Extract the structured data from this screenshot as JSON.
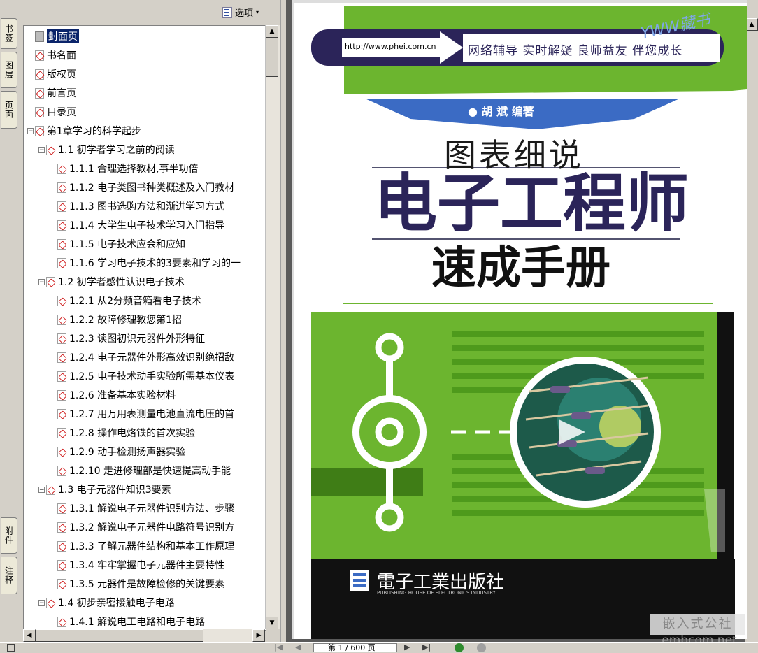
{
  "left_tabs": [
    "书签",
    "图层",
    "页面",
    "附件",
    "注释"
  ],
  "panel": {
    "options_label": "选项",
    "close_glyph": "×"
  },
  "tree": [
    {
      "label": "封面页",
      "level": 0,
      "icon": "page",
      "toggle": "",
      "selected": true
    },
    {
      "label": "书名面",
      "level": 0,
      "icon": "pdf",
      "toggle": ""
    },
    {
      "label": "版权页",
      "level": 0,
      "icon": "pdf",
      "toggle": ""
    },
    {
      "label": "前言页",
      "level": 0,
      "icon": "pdf",
      "toggle": ""
    },
    {
      "label": "目录页",
      "level": 0,
      "icon": "pdf",
      "toggle": ""
    },
    {
      "label": "第1章学习的科学起步",
      "level": 0,
      "icon": "pdf",
      "toggle": "-"
    },
    {
      "label": "1.1 初学者学习之前的阅读",
      "level": 1,
      "icon": "pdf",
      "toggle": "-"
    },
    {
      "label": "1.1.1 合理选择教材,事半功倍",
      "level": 2,
      "icon": "pdf",
      "toggle": ""
    },
    {
      "label": "1.1.2 电子类图书种类概述及入门教材",
      "level": 2,
      "icon": "pdf",
      "toggle": ""
    },
    {
      "label": "1.1.3 图书选购方法和渐进学习方式",
      "level": 2,
      "icon": "pdf",
      "toggle": ""
    },
    {
      "label": "1.1.4 大学生电子技术学习入门指导",
      "level": 2,
      "icon": "pdf",
      "toggle": ""
    },
    {
      "label": "1.1.5 电子技术应会和应知",
      "level": 2,
      "icon": "pdf",
      "toggle": ""
    },
    {
      "label": "1.1.6 学习电子技术的3要素和学习的一",
      "level": 2,
      "icon": "pdf",
      "toggle": ""
    },
    {
      "label": "1.2 初学者感性认识电子技术",
      "level": 1,
      "icon": "pdf",
      "toggle": "-"
    },
    {
      "label": "1.2.1 从2分频音箱看电子技术",
      "level": 2,
      "icon": "pdf",
      "toggle": ""
    },
    {
      "label": "1.2.2 故障修理教您第1招",
      "level": 2,
      "icon": "pdf",
      "toggle": ""
    },
    {
      "label": "1.2.3 读图初识元器件外形特征",
      "level": 2,
      "icon": "pdf",
      "toggle": ""
    },
    {
      "label": "1.2.4 电子元器件外形高效识别绝招敌",
      "level": 2,
      "icon": "pdf",
      "toggle": ""
    },
    {
      "label": "1.2.5 电子技术动手实验所需基本仪表",
      "level": 2,
      "icon": "pdf",
      "toggle": ""
    },
    {
      "label": "1.2.6 准备基本实验材料",
      "level": 2,
      "icon": "pdf",
      "toggle": ""
    },
    {
      "label": "1.2.7 用万用表测量电池直流电压的首",
      "level": 2,
      "icon": "pdf",
      "toggle": ""
    },
    {
      "label": "1.2.8 操作电烙铁的首次实验",
      "level": 2,
      "icon": "pdf",
      "toggle": ""
    },
    {
      "label": "1.2.9 动手检测扬声器实验",
      "level": 2,
      "icon": "pdf",
      "toggle": ""
    },
    {
      "label": "1.2.10 走进修理部是快速提高动手能",
      "level": 2,
      "icon": "pdf",
      "toggle": ""
    },
    {
      "label": "1.3 电子元器件知识3要素",
      "level": 1,
      "icon": "pdf",
      "toggle": "-"
    },
    {
      "label": "1.3.1 解说电子元器件识别方法、步骤",
      "level": 2,
      "icon": "pdf",
      "toggle": ""
    },
    {
      "label": "1.3.2 解说电子元器件电路符号识别方",
      "level": 2,
      "icon": "pdf",
      "toggle": ""
    },
    {
      "label": "1.3.3 了解元器件结构和基本工作原理",
      "level": 2,
      "icon": "pdf",
      "toggle": ""
    },
    {
      "label": "1.3.4 牢牢掌握电子元器件主要特性",
      "level": 2,
      "icon": "pdf",
      "toggle": ""
    },
    {
      "label": "1.3.5 元器件是故障检修的关键要素",
      "level": 2,
      "icon": "pdf",
      "toggle": ""
    },
    {
      "label": "1.4 初步亲密接触电子电路",
      "level": 1,
      "icon": "pdf",
      "toggle": "-"
    },
    {
      "label": "1.4.1 解说电工电路和电子电路",
      "level": 2,
      "icon": "pdf",
      "toggle": ""
    }
  ],
  "cover": {
    "url": "http://www.phei.com.cn",
    "slogan": "网络辅导  实时解疑  良师益友  伴您成长",
    "stamp": "YWW藏书",
    "author": "● 胡    斌    编著",
    "title_top": "图表细说",
    "title_main": "电子工程师",
    "title_bottom": "速成手册",
    "publisher": "電子工業出版社",
    "publisher_en": "PUBLISHING HOUSE OF ELECTRONICS INDUSTRY"
  },
  "status": {
    "page_display": "第 1 / 600 页"
  },
  "watermark": {
    "line1": "嵌入式公社",
    "line2": "embcom.net"
  },
  "colors": {
    "accent_green": "#6cb52f",
    "dark_navy": "#2b2459",
    "selection": "#0a246a",
    "cover_blue": "#3b6bc4"
  }
}
